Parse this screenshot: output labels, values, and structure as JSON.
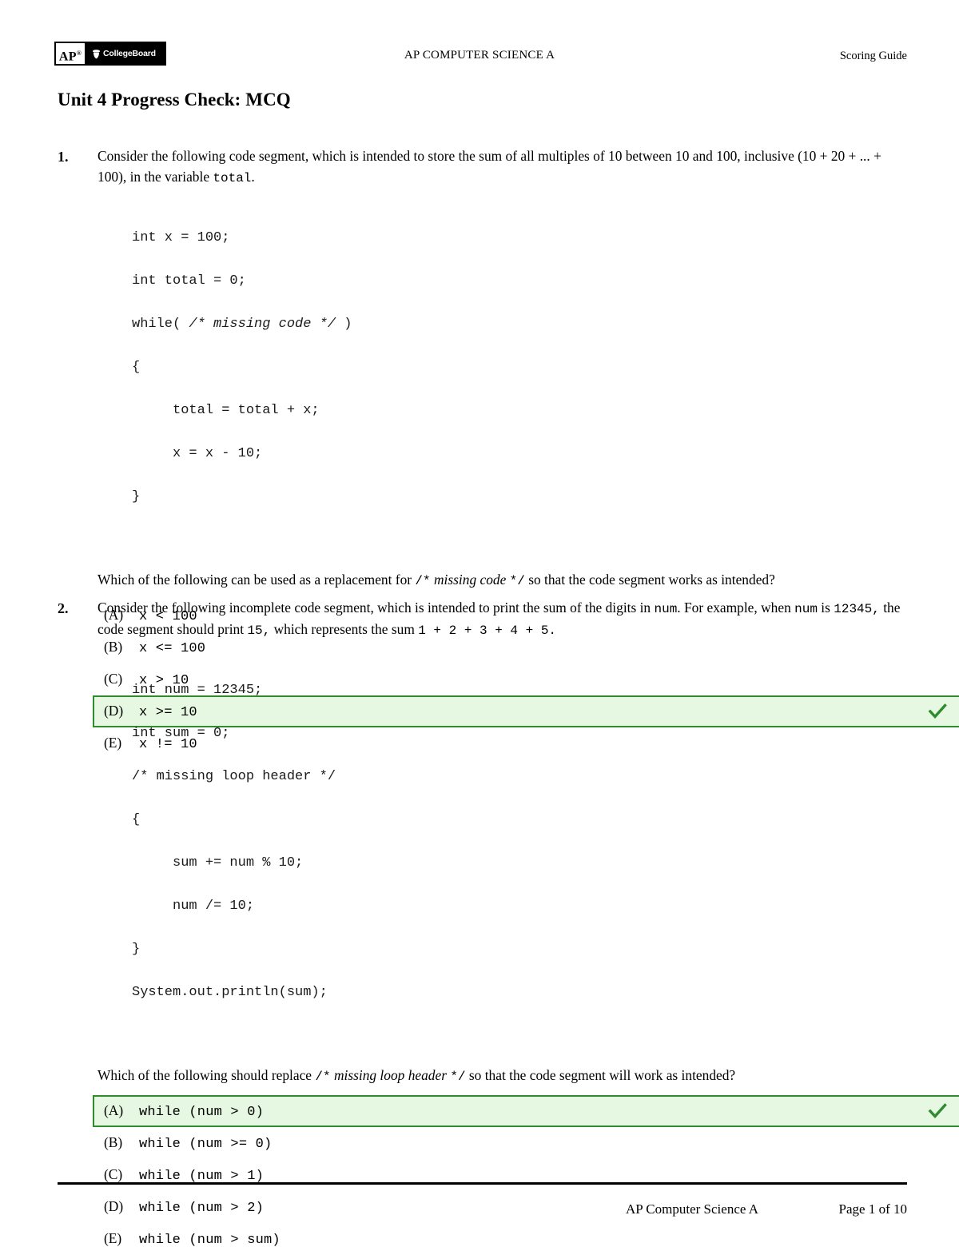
{
  "header": {
    "logo": {
      "ap_label": "AP",
      "collegeboard_label": "CollegeBoard",
      "acorn_icon": "acorn-icon"
    },
    "center_title": "AP COMPUTER SCIENCE A",
    "right_label": "Scoring Guide"
  },
  "document": {
    "title": "Unit 4 Progress Check: MCQ"
  },
  "questions": [
    {
      "number": "1.",
      "stem_parts": [
        {
          "type": "text",
          "value": "Consider the following code segment, which is intended to store the sum of all multiples of 10 between 10 and 100, inclusive (10 + 20 + ... + 100), in the variable "
        },
        {
          "type": "mono",
          "value": "total"
        },
        {
          "type": "text",
          "value": "."
        }
      ],
      "stem_plain": "Consider the following code segment, which is intended to store the sum of all multiples of 10 between 10 and 100, inclusive (10 + 20 + ... + 100), in the variable total.",
      "code": [
        "int x = 100;",
        "int total = 0;",
        "while( /* missing code */ )",
        "{",
        "     total = total + x;",
        "     x = x - 10;",
        "}"
      ],
      "code_comment": "/* missing code */",
      "prompt_plain": "Which of the following can be used as a replacement for /* missing code */ so that the code segment works as intended?",
      "prompt_before": "Which of the following can be used as a replacement for ",
      "prompt_comment_open": "/*",
      "prompt_comment_text": "missing code",
      "prompt_comment_close": "*/",
      "prompt_after": " so that the code segment works as intended?",
      "choices": [
        {
          "letter": "(A)",
          "text": "x < 100",
          "correct": false
        },
        {
          "letter": "(B)",
          "text": "x <= 100",
          "correct": false
        },
        {
          "letter": "(C)",
          "text": "x > 10",
          "correct": false
        },
        {
          "letter": "(D)",
          "text": "x >= 10",
          "correct": true
        },
        {
          "letter": "(E)",
          "text": "x != 10",
          "correct": false
        }
      ],
      "correct_answer": "D"
    },
    {
      "number": "2.",
      "stem_plain": "Consider the following incomplete code segment, which is intended to print the sum of the digits in num. For example, when num is 12345, the code segment should print 15, which represents the sum 1 + 2 + 3 + 4 + 5.",
      "stem_s1": "Consider the following incomplete code segment, which is intended to print the sum of the digits in ",
      "stem_m1": "num",
      "stem_s2": ". For example, when ",
      "stem_m2": "num",
      "stem_s3": " is ",
      "stem_m3": "12345,",
      "stem_s4": " the code segment should print ",
      "stem_m4": "15,",
      "stem_s5": " which represents the sum ",
      "stem_m5": "1 + 2 + 3 + 4 + 5.",
      "code": [
        "int num = 12345;",
        "int sum = 0;",
        "/* missing loop header */",
        "{",
        "     sum += num % 10;",
        "     num /= 10;",
        "}",
        "System.out.println(sum);"
      ],
      "code_comment": "/* missing loop header */",
      "prompt_plain": "Which of the following should replace /* missing loop header */ so that the code segment will work as intended?",
      "prompt_before": "Which of the following should replace ",
      "prompt_comment_open": "/*",
      "prompt_comment_text": "missing loop header",
      "prompt_comment_close": "*/",
      "prompt_after": " so that the code segment will work as intended?",
      "choices": [
        {
          "letter": "(A)",
          "text": "while (num > 0)",
          "correct": true
        },
        {
          "letter": "(B)",
          "text": "while (num >= 0)",
          "correct": false
        },
        {
          "letter": "(C)",
          "text": "while (num > 1)",
          "correct": false
        },
        {
          "letter": "(D)",
          "text": "while (num > 2)",
          "correct": false
        },
        {
          "letter": "(E)",
          "text": "while (num > sum)",
          "correct": false
        }
      ],
      "correct_answer": "A"
    }
  ],
  "footer": {
    "left": "AP Computer Science A",
    "right": "Page 1 of 10"
  },
  "colors": {
    "correct_fill": "#e6f8e2",
    "correct_border": "#2e8b2e",
    "check": "#2e8b2e",
    "text": "#000000"
  }
}
